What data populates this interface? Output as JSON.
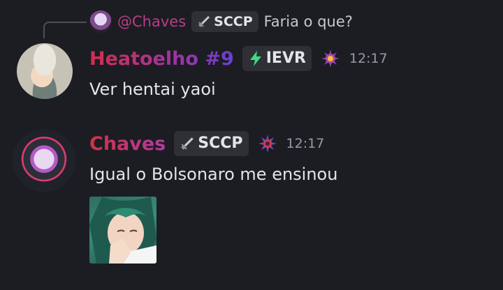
{
  "reply": {
    "author": "@Chaves",
    "tag": "SCCP",
    "text": "Faria o que?"
  },
  "messages": [
    {
      "author": "Heatoelho #9",
      "tag": "IEVR",
      "time": "12:17",
      "text": "Ver hentai yaoi"
    },
    {
      "author": "Chaves",
      "tag": "SCCP",
      "time": "12:17",
      "text": "Igual o Bolsonaro me ensinou",
      "attachment": "image-attachment"
    }
  ],
  "colors": {
    "background": "#1c1d22",
    "tag_background": "#2e3036",
    "timestamp": "#949ba4",
    "message_text": "#e3e5e8",
    "reply_author": "#b93d86",
    "bolt": "#3ddc84"
  }
}
